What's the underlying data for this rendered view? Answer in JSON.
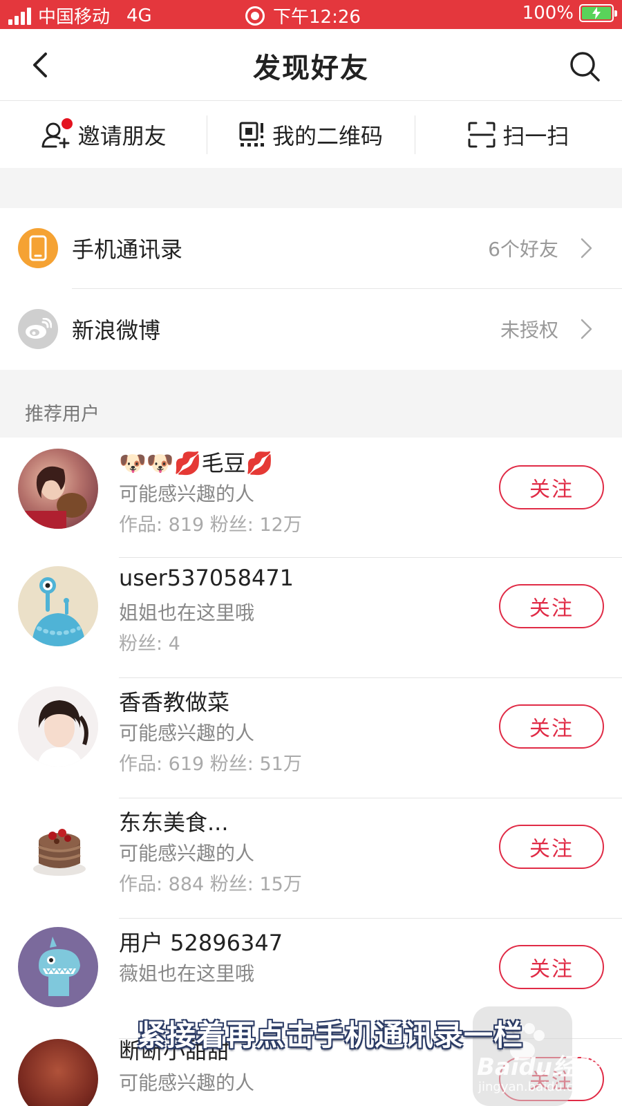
{
  "status_bar": {
    "carrier": "中国移动",
    "network": "4G",
    "time": "下午12:26",
    "battery": "100%"
  },
  "nav": {
    "title": "发现好友"
  },
  "quick_actions": [
    {
      "label": "邀请朋友",
      "icon": "add-user-icon"
    },
    {
      "label": "我的二维码",
      "icon": "qr-code-icon"
    },
    {
      "label": "扫一扫",
      "icon": "scan-icon"
    }
  ],
  "sources": [
    {
      "label": "手机通讯录",
      "value": "6个好友",
      "icon": "phone-icon",
      "color": "#f5a233"
    },
    {
      "label": "新浪微博",
      "value": "未授权",
      "icon": "weibo-icon",
      "color": "#cccccc"
    }
  ],
  "section": {
    "title": "推荐用户"
  },
  "users": [
    {
      "name": "🐶🐶💋毛豆💋",
      "reason": "可能感兴趣的人",
      "stats": "作品: 819  粉丝: 12万",
      "follow": "关注"
    },
    {
      "name": "user537058471",
      "reason": "姐姐也在这里哦",
      "stats": "粉丝: 4",
      "follow": "关注"
    },
    {
      "name": "香香教做菜",
      "reason": "可能感兴趣的人",
      "stats": "作品: 619  粉丝: 51万",
      "follow": "关注"
    },
    {
      "name": "东东美食...",
      "reason": "可能感兴趣的人",
      "stats": "作品: 884  粉丝: 15万",
      "follow": "关注"
    },
    {
      "name": "用户 52896347",
      "reason": "薇姐也在这里哦",
      "stats": "",
      "follow": "关注"
    },
    {
      "name": "断断小甜甜",
      "reason": "可能感兴趣的人",
      "stats": "",
      "follow": "关注"
    }
  ],
  "overlay": {
    "subtitle": "紧接着再点击手机通讯录一栏",
    "watermark_brand": "Baidu经验",
    "watermark_url": "jingyan.baidu.com"
  },
  "colors": {
    "status_bar": "#e4373d",
    "accent": "#e02b46",
    "contacts_icon": "#f5a233"
  }
}
